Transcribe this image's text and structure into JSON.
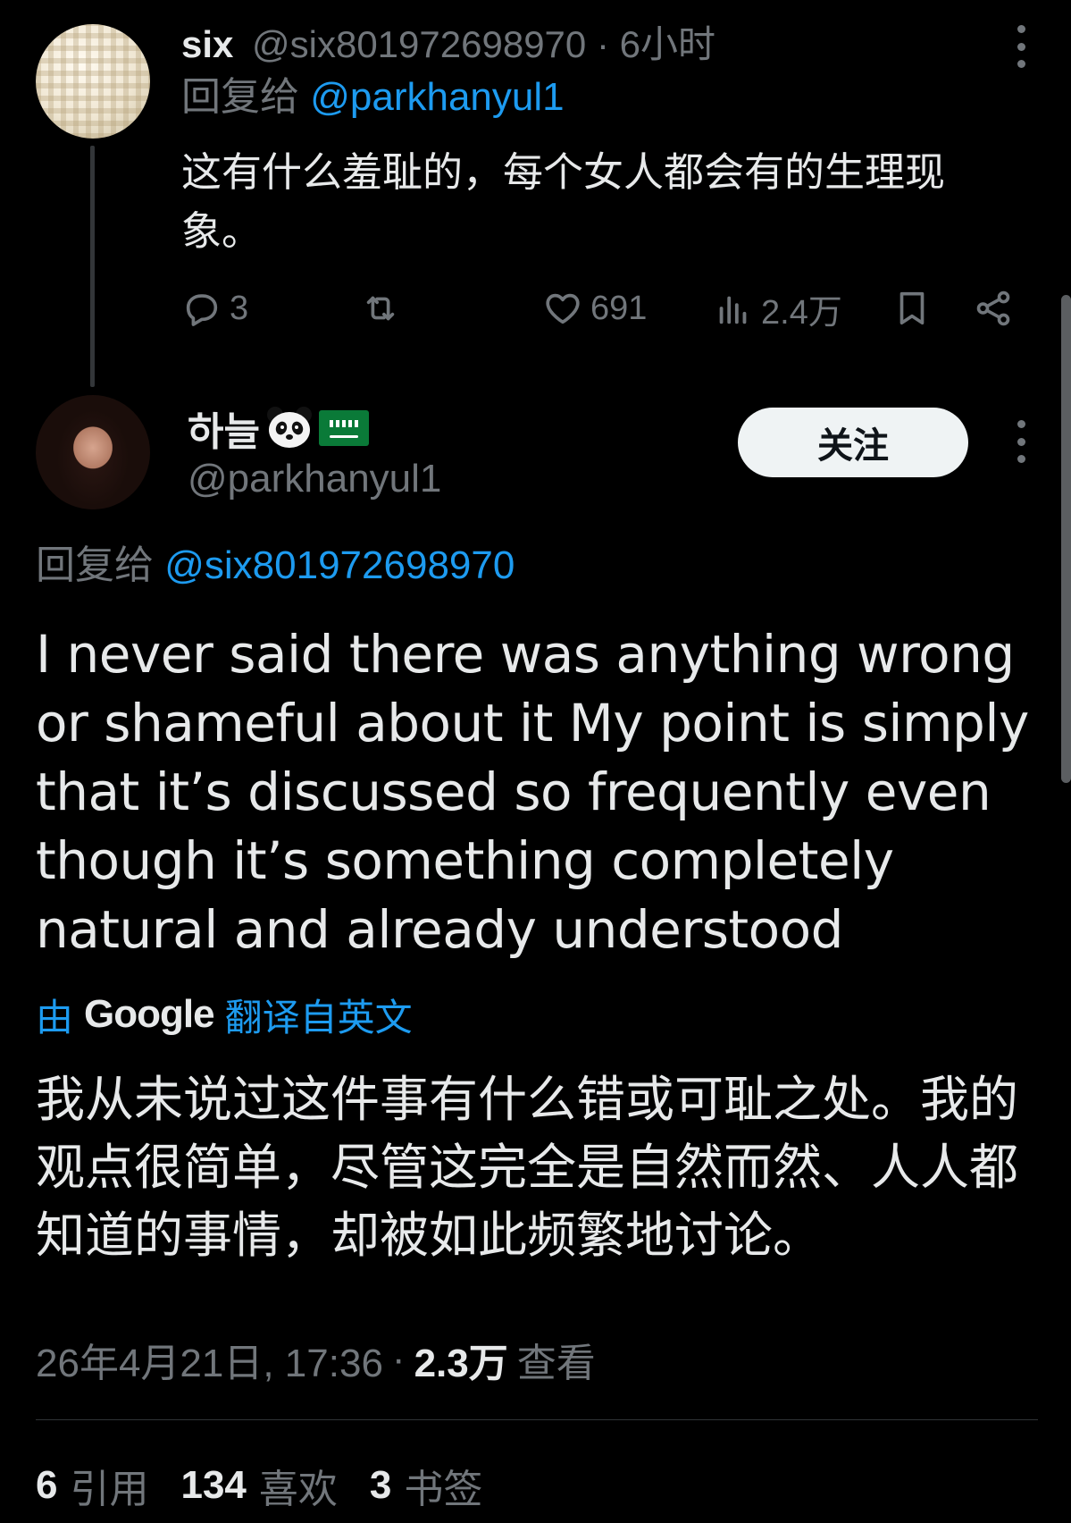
{
  "reply_tweet": {
    "author_name": "six",
    "handle": "@six801972698970",
    "separator": "·",
    "time_ago": "6小时",
    "reply_prefix": "回复给",
    "reply_mention": "@parkhanyul1",
    "text": "这有什么羞耻的，每个女人都会有的生理现象。",
    "actions": {
      "replies": "3",
      "retweets": "",
      "likes": "691",
      "views": "2.4万"
    }
  },
  "main_tweet": {
    "author_name": "하늘",
    "handle": "@parkhanyul1",
    "follow_label": "关注",
    "reply_prefix": "回复给",
    "reply_mention": "@six801972698970",
    "text": "I never said there was anything wrong or shameful about it My point is simply that it’s discussed so frequently even though it’s something completely natural and already understood",
    "translated_by_prefix": "由",
    "translated_by_brand": "Google",
    "translated_by_suffix": "翻译自英文",
    "translated_text": "我从未说过这件事有什么错或可耻之处。我的观点很简单，尽管这完全是自然而然、人人都知道的事情，却被如此频繁地讨论。",
    "timestamp": "26年4月21日, 17:36",
    "separator": "·",
    "views_count": "2.3万",
    "views_label": "查看",
    "stats": [
      {
        "count": "6",
        "label": "引用"
      },
      {
        "count": "134",
        "label": "喜欢"
      },
      {
        "count": "3",
        "label": "书签"
      }
    ]
  },
  "colors": {
    "background": "#000000",
    "text_primary": "#e7e9ea",
    "text_secondary": "#71767b",
    "link": "#1d9bf0",
    "follow_button_bg": "#eff3f4"
  },
  "icons": [
    "more-icon",
    "reply-icon",
    "retweet-icon",
    "like-icon",
    "views-icon",
    "bookmark-icon",
    "share-icon",
    "panda-emoji",
    "saudi-flag-emoji"
  ]
}
